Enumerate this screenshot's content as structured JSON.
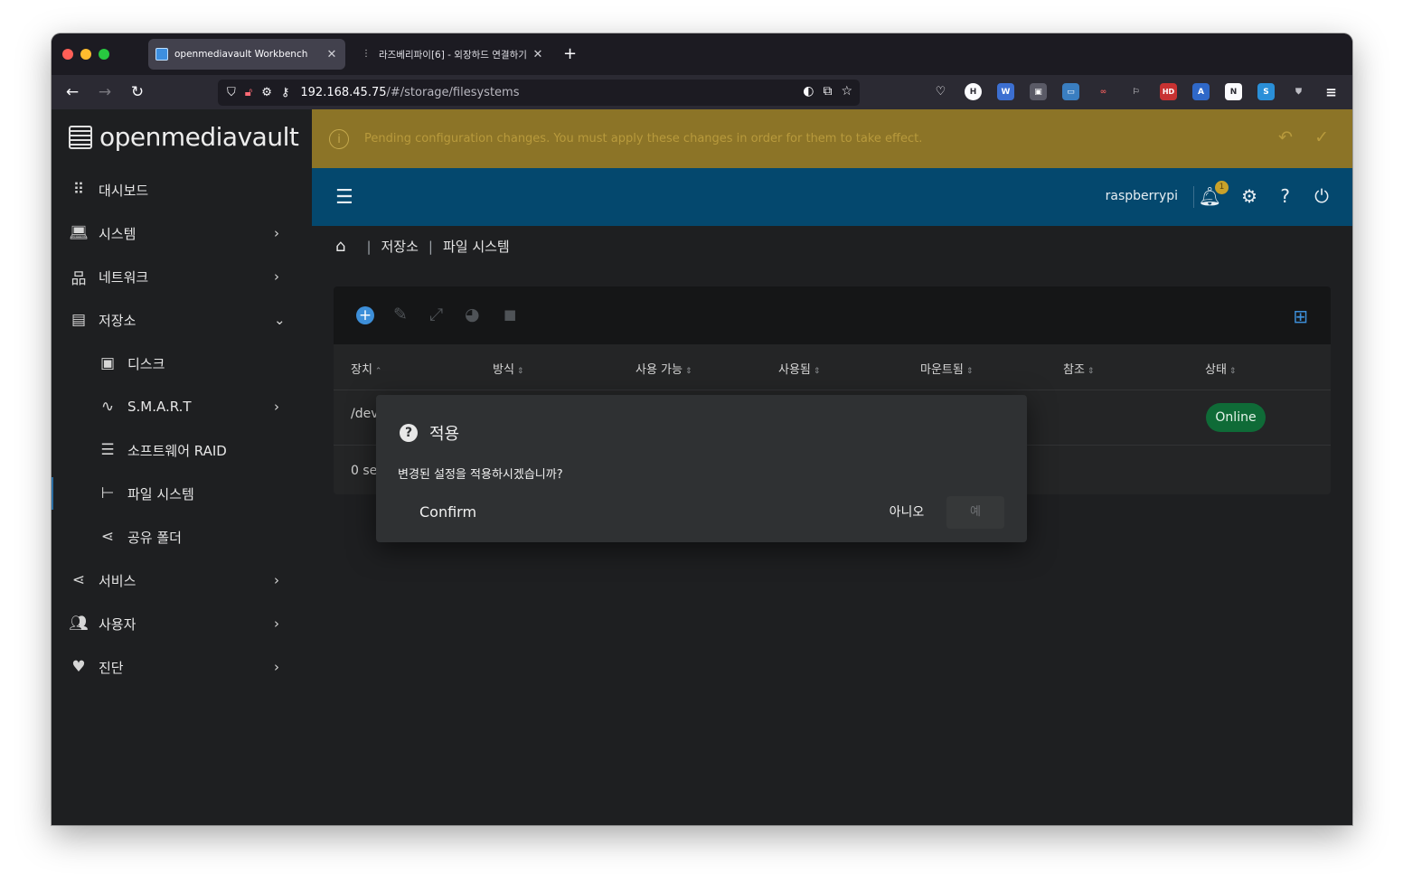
{
  "browser": {
    "tabs": [
      {
        "title": "openmediavault Workbench",
        "close": "✕"
      },
      {
        "title": "라즈베리파이[6] - 외장하드 연결하기",
        "close": "✕"
      }
    ],
    "new_tab": "+",
    "url_host": "192.168.45.75",
    "url_path": "/#/storage/filesystems"
  },
  "app": {
    "brand": "openmediavault",
    "sidebar": {
      "items": [
        {
          "label": "대시보드",
          "icon": "grid-icon"
        },
        {
          "label": "시스템",
          "icon": "laptop-icon",
          "chevron": "›"
        },
        {
          "label": "네트워크",
          "icon": "network-icon",
          "chevron": "›"
        },
        {
          "label": "저장소",
          "icon": "storage-icon",
          "chevron": "⌄"
        },
        {
          "label": "디스크",
          "icon": "disk-icon"
        },
        {
          "label": "S.M.A.R.T",
          "icon": "pulse-icon",
          "chevron": "›"
        },
        {
          "label": "소프트웨어 RAID",
          "icon": "database-icon"
        },
        {
          "label": "파일 시스템",
          "icon": "tree-icon"
        },
        {
          "label": "공유 폴더",
          "icon": "share-icon"
        },
        {
          "label": "서비스",
          "icon": "share-icon",
          "chevron": "›"
        },
        {
          "label": "사용자",
          "icon": "users-icon",
          "chevron": "›"
        },
        {
          "label": "진단",
          "icon": "heartbeat-icon",
          "chevron": "›"
        }
      ]
    },
    "banner": {
      "message": "Pending configuration changes. You must apply these changes in order for them to take effect."
    },
    "topbar": {
      "hostname": "raspberrypi",
      "notification_count": "1"
    },
    "breadcrumb": [
      "저장소",
      "파일 시스템"
    ],
    "table": {
      "columns": [
        "장치",
        "방식",
        "사용 가능",
        "사용됨",
        "마운트됨",
        "참조",
        "상태"
      ],
      "row": {
        "device": "/dev",
        "status": "Online"
      },
      "footer": "0 se"
    },
    "dialog": {
      "title": "적용",
      "body": "변경된 설정을 적용하시겠습니까?",
      "confirm": "Confirm",
      "no": "아니오",
      "yes": "예"
    }
  },
  "colors": {
    "banner": "#8c7427",
    "topbar": "#04486e",
    "accent": "#3d8fd9",
    "online": "#0f6b37"
  }
}
